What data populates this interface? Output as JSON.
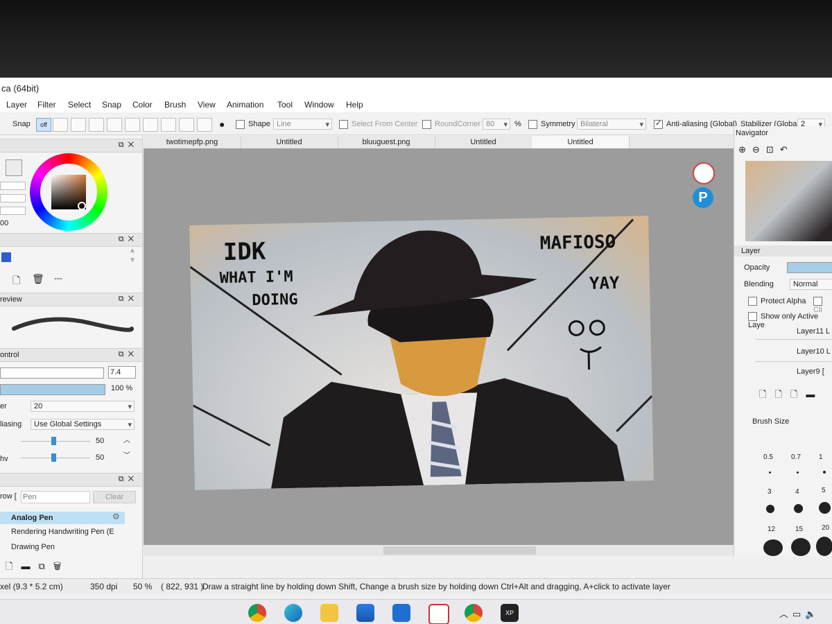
{
  "app": {
    "title": "ca (64bit)"
  },
  "menu": [
    "Layer",
    "Filter",
    "Select",
    "Snap",
    "Color",
    "Brush",
    "View",
    "Animation",
    "Tool",
    "Window",
    "Help"
  ],
  "toolbar": {
    "snap_label": "Snap",
    "snap_off": "off",
    "shape_label": "Shape",
    "shape_value": "Line",
    "select_from_center": "Select From Center",
    "round_corner": "RoundCorner",
    "round_corner_value": "80",
    "percent": "%",
    "symmetry": "Symmetry",
    "symmetry_value": "Bilateral",
    "antialiasing": "Anti-aliasing (Global)",
    "stabilizer_label": "Stabilizer (Global)",
    "stabilizer_value": "2"
  },
  "tabs": [
    "twotimepfp.png",
    "Untitled",
    "bluuguest.png",
    "Untitled",
    "Untitled"
  ],
  "left": {
    "color_value": "00",
    "preview_header": "review",
    "control_header": "ontrol",
    "brush_size": "7.4",
    "density": "100 %",
    "filter_label": "er",
    "filter_value": "20",
    "aliasing_label": "liasing",
    "aliasing_value": "Use Global Settings",
    "slider1": "50",
    "slider2": "50",
    "hv_label": "hv",
    "brush_filter_label": "row [",
    "brush_filter_placeholder": "Pen",
    "clear_label": "Clear",
    "brushes": [
      "Analog Pen",
      "Rendering Handwriting Pen (E",
      "Drawing Pen"
    ]
  },
  "artwork": {
    "text_left_1": "IDK",
    "text_left_2": "WHAT I'M",
    "text_left_3": "DOING",
    "text_right_1": "MAFIOSO",
    "text_right_2": "YAY"
  },
  "right": {
    "navigator_label": "Navigator",
    "layer_label": "Layer",
    "opacity_label": "Opacity",
    "blending_label": "Blending",
    "blending_value": "Normal",
    "protect_alpha": "Protect Alpha",
    "clip": "Cli",
    "show_only_active": "Show only Active Laye",
    "layers": [
      "Layer11 L",
      "Layer10 L",
      "Layer9 ["
    ],
    "brush_size_label": "Brush Size",
    "sizes": [
      "0.5",
      "0.7",
      "1",
      "3",
      "4",
      "5",
      "12",
      "15",
      "20"
    ]
  },
  "status": {
    "size": "xel  (9.3 * 5.2 cm)",
    "dpi": "350 dpi",
    "zoom": "50 %",
    "coords": "( 822, 931 )",
    "hint": "Draw a straight line by holding down Shift, Change a brush size by holding down Ctrl+Alt and dragging, A+click to activate layer"
  },
  "colors": {
    "accent": "#cfe3f7",
    "hat": "#241d1f",
    "skin": "#d79a3f",
    "tie_blue": "#5c6680"
  }
}
